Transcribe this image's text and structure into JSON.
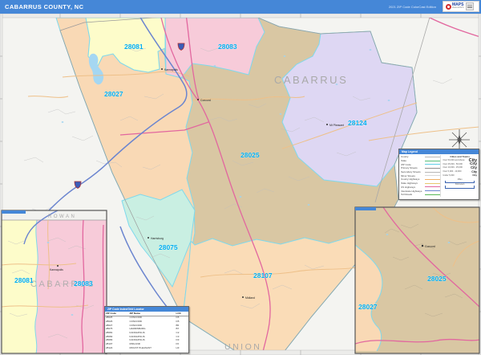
{
  "header": {
    "title": "CABARRUS COUNTY, NC",
    "edition": "2021 ZIP Code ColorCast Edition",
    "logo": {
      "brand": "MAPS",
      "publisher": "MarketMAPS"
    }
  },
  "colors": {
    "header_blue": "#4587d7",
    "zip_label_cyan": "#00aeef",
    "county_label_gray": "#a9a9a9",
    "zip_28025": "#d9c7a3",
    "zip_28027": "#f9d9b5",
    "zip_28081": "#fdfcca",
    "zip_28083": "#f7cbd9",
    "zip_28124": "#ded7f3",
    "zip_28075": "#c9efe2",
    "zip_28107": "#fadcb7",
    "water": "#a5d7f2",
    "us_highway": "#e2679f",
    "interstate": "#6b85cf",
    "secondary_road": "#eec089"
  },
  "map": {
    "zip_labels": {
      "z28027": "28027",
      "z28081": "28081",
      "z28083": "28083",
      "z28025": "28025",
      "z28124": "28124",
      "z28075": "28075",
      "z28107": "28107"
    },
    "county_labels": {
      "cabarrus": "CABARRUS",
      "union": "UNION"
    },
    "towns": {
      "kannapolis": "Kannapolis",
      "concord": "Concord",
      "harrisburg": "Harrisburg",
      "midland": "Midland",
      "mt_pleasant": "Mt Pleasant"
    }
  },
  "inset_left": {
    "county_top": "ROWAN",
    "county_main": "CABARRUS",
    "town": "Kannapolis",
    "zip_left": "28081",
    "zip_right": "28083"
  },
  "inset_right": {
    "town": "Concord",
    "zip_main": "28025",
    "zip_left": "28027"
  },
  "legend": {
    "title": "Map Legend",
    "line_items": [
      {
        "label": "County",
        "color": "#b9b9b9",
        "w": 1
      },
      {
        "label": "State",
        "color": "#58c07a",
        "w": 1
      },
      {
        "label": "ZIP Code",
        "color": "#62cfe8",
        "w": 1
      },
      {
        "label": "Primary Streets",
        "color": "#8f8f8f",
        "w": 1
      },
      {
        "label": "Secondary Streets",
        "color": "#b5b5b5",
        "w": 1
      },
      {
        "label": "Minor Streets",
        "color": "#d8d8d8",
        "w": 1
      },
      {
        "label": "County Highways",
        "color": "#f0b066",
        "w": 1.5
      },
      {
        "label": "State Highways",
        "color": "#e8c86e",
        "w": 1.5
      },
      {
        "label": "US Highways",
        "color": "#e2679f",
        "w": 1.5
      },
      {
        "label": "Interstate Highways",
        "color": "#6b85cf",
        "w": 1.5
      },
      {
        "label": "Toll Roads",
        "color": "#58b858",
        "w": 1.5
      }
    ],
    "cities_title": "Cities and Towns",
    "city_classes": [
      {
        "range": "Over 50,000 and Above",
        "sample": "City"
      },
      {
        "range": "Over 25,000 - 50,000",
        "sample": "City"
      },
      {
        "range": "Over 10,000 - 25,000",
        "sample": "City"
      },
      {
        "range": "Over 5,000 - 10,000",
        "sample": "City"
      },
      {
        "range": "Under 5,000",
        "sample": "City"
      }
    ],
    "scale_miles": "Miles",
    "scale_km": "Kilometers"
  },
  "zip_table": {
    "title": "ZIP Code Index/Grid Locator",
    "columns": [
      "ZIP Code",
      "ZIP Name",
      "LOC"
    ],
    "rows": [
      [
        "28025",
        "CONCORD",
        "D5"
      ],
      [
        "28026",
        "CONCORD",
        "D5"
      ],
      [
        "28027",
        "CONCORD",
        "B5"
      ],
      [
        "28075",
        "HARRISBURG",
        "B7"
      ],
      [
        "28081",
        "KANNAPOLIS",
        "C2"
      ],
      [
        "28082",
        "KANNAPOLIS",
        "C3"
      ],
      [
        "28083",
        "KANNAPOLIS",
        "D3"
      ],
      [
        "28107",
        "MIDLAND",
        "F6"
      ],
      [
        "28124",
        "MOUNT PLEASANT",
        "H3"
      ]
    ]
  }
}
